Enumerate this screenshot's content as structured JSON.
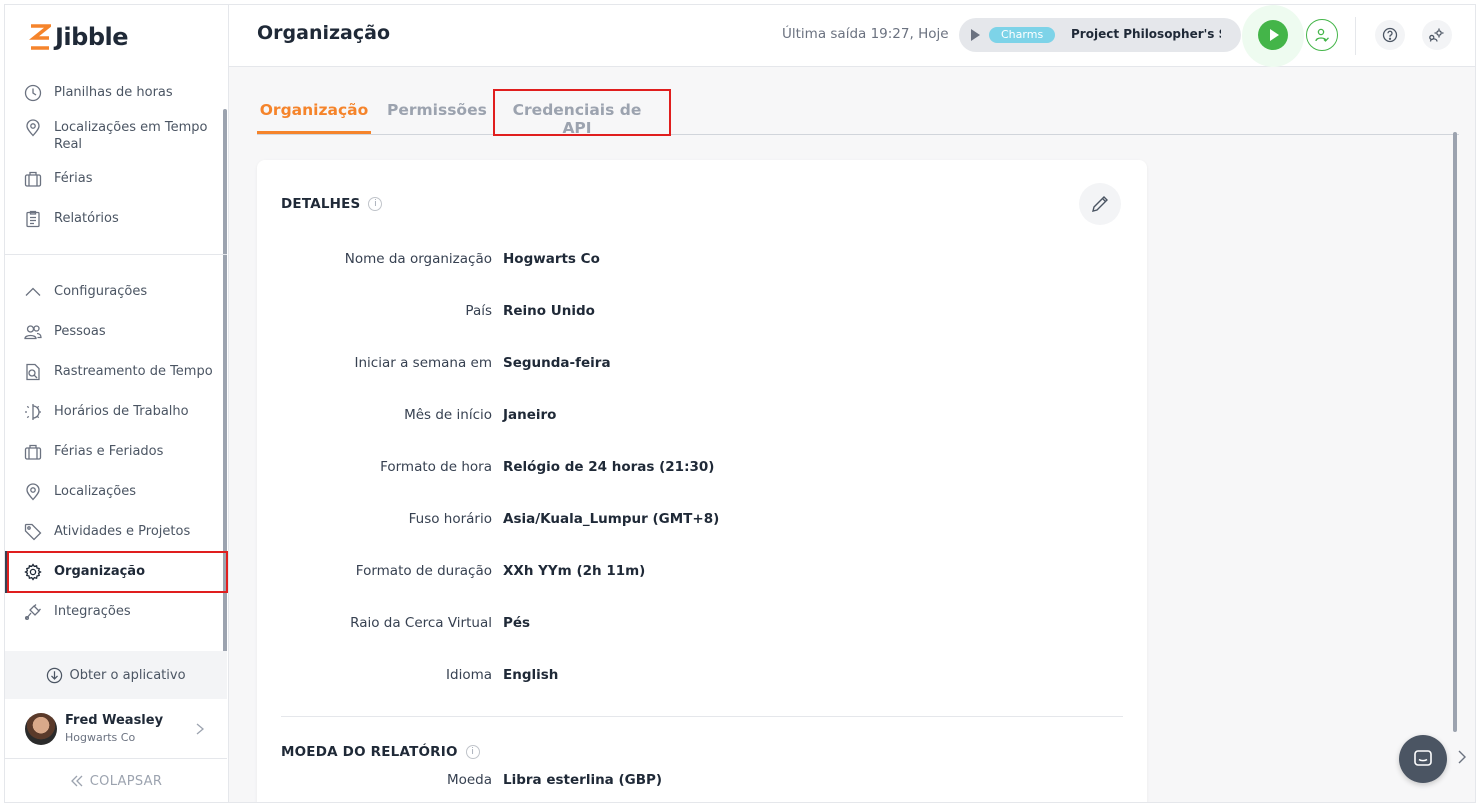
{
  "brand": {
    "name": "Jibble",
    "accent": "#f5842b",
    "green": "#44b549"
  },
  "sidebar": {
    "top_items": [
      {
        "label": "Planilhas de horas",
        "icon": "clock-icon"
      },
      {
        "label": "Localizações em Tempo Real",
        "icon": "location-pin-icon"
      },
      {
        "label": "Férias",
        "icon": "briefcase-icon"
      },
      {
        "label": "Relatórios",
        "icon": "clipboard-icon"
      }
    ],
    "settings_items": [
      {
        "label": "Configurações",
        "icon": "chevron-up-icon"
      },
      {
        "label": "Pessoas",
        "icon": "people-icon"
      },
      {
        "label": "Rastreamento de Tempo",
        "icon": "time-tracking-icon"
      },
      {
        "label": "Horários de Trabalho",
        "icon": "work-schedule-icon"
      },
      {
        "label": "Férias e Feriados",
        "icon": "briefcase-icon"
      },
      {
        "label": "Localizações",
        "icon": "location-pin-icon"
      },
      {
        "label": "Atividades e Projetos",
        "icon": "tag-icon"
      },
      {
        "label": "Organização",
        "icon": "gear-icon",
        "active": true
      },
      {
        "label": "Integrações",
        "icon": "plug-icon"
      }
    ],
    "get_app": "Obter o aplicativo",
    "user": {
      "name": "Fred Weasley",
      "org": "Hogwarts Co"
    },
    "collapse": "COLAPSAR"
  },
  "header": {
    "title": "Organização",
    "last_out": "Última saída 19:27, Hoje",
    "timer": {
      "activity": "Charms",
      "project": "Project Philosopher's St..."
    }
  },
  "tabs": [
    {
      "label": "Organização",
      "active": true
    },
    {
      "label": "Permissões",
      "active": false
    },
    {
      "label": "Credenciais de API",
      "active": false
    }
  ],
  "details": {
    "title": "DETALHES",
    "rows": [
      {
        "label": "Nome da organização",
        "value": "Hogwarts Co"
      },
      {
        "label": "País",
        "value": "Reino Unido"
      },
      {
        "label": "Iniciar a semana em",
        "value": "Segunda-feira"
      },
      {
        "label": "Mês de início",
        "value": "Janeiro"
      },
      {
        "label": "Formato de hora",
        "value": "Relógio de 24 horas (21:30)"
      },
      {
        "label": "Fuso horário",
        "value": "Asia/Kuala_Lumpur (GMT+8)"
      },
      {
        "label": "Formato de duração",
        "value": "XXh YYm (2h 11m)"
      },
      {
        "label": "Raio da Cerca Virtual",
        "value": "Pés"
      },
      {
        "label": "Idioma",
        "value": "English"
      }
    ]
  },
  "currency": {
    "title": "MOEDA DO RELATÓRIO",
    "rows": [
      {
        "label": "Moeda",
        "value": "Libra esterlina (GBP)"
      }
    ]
  }
}
